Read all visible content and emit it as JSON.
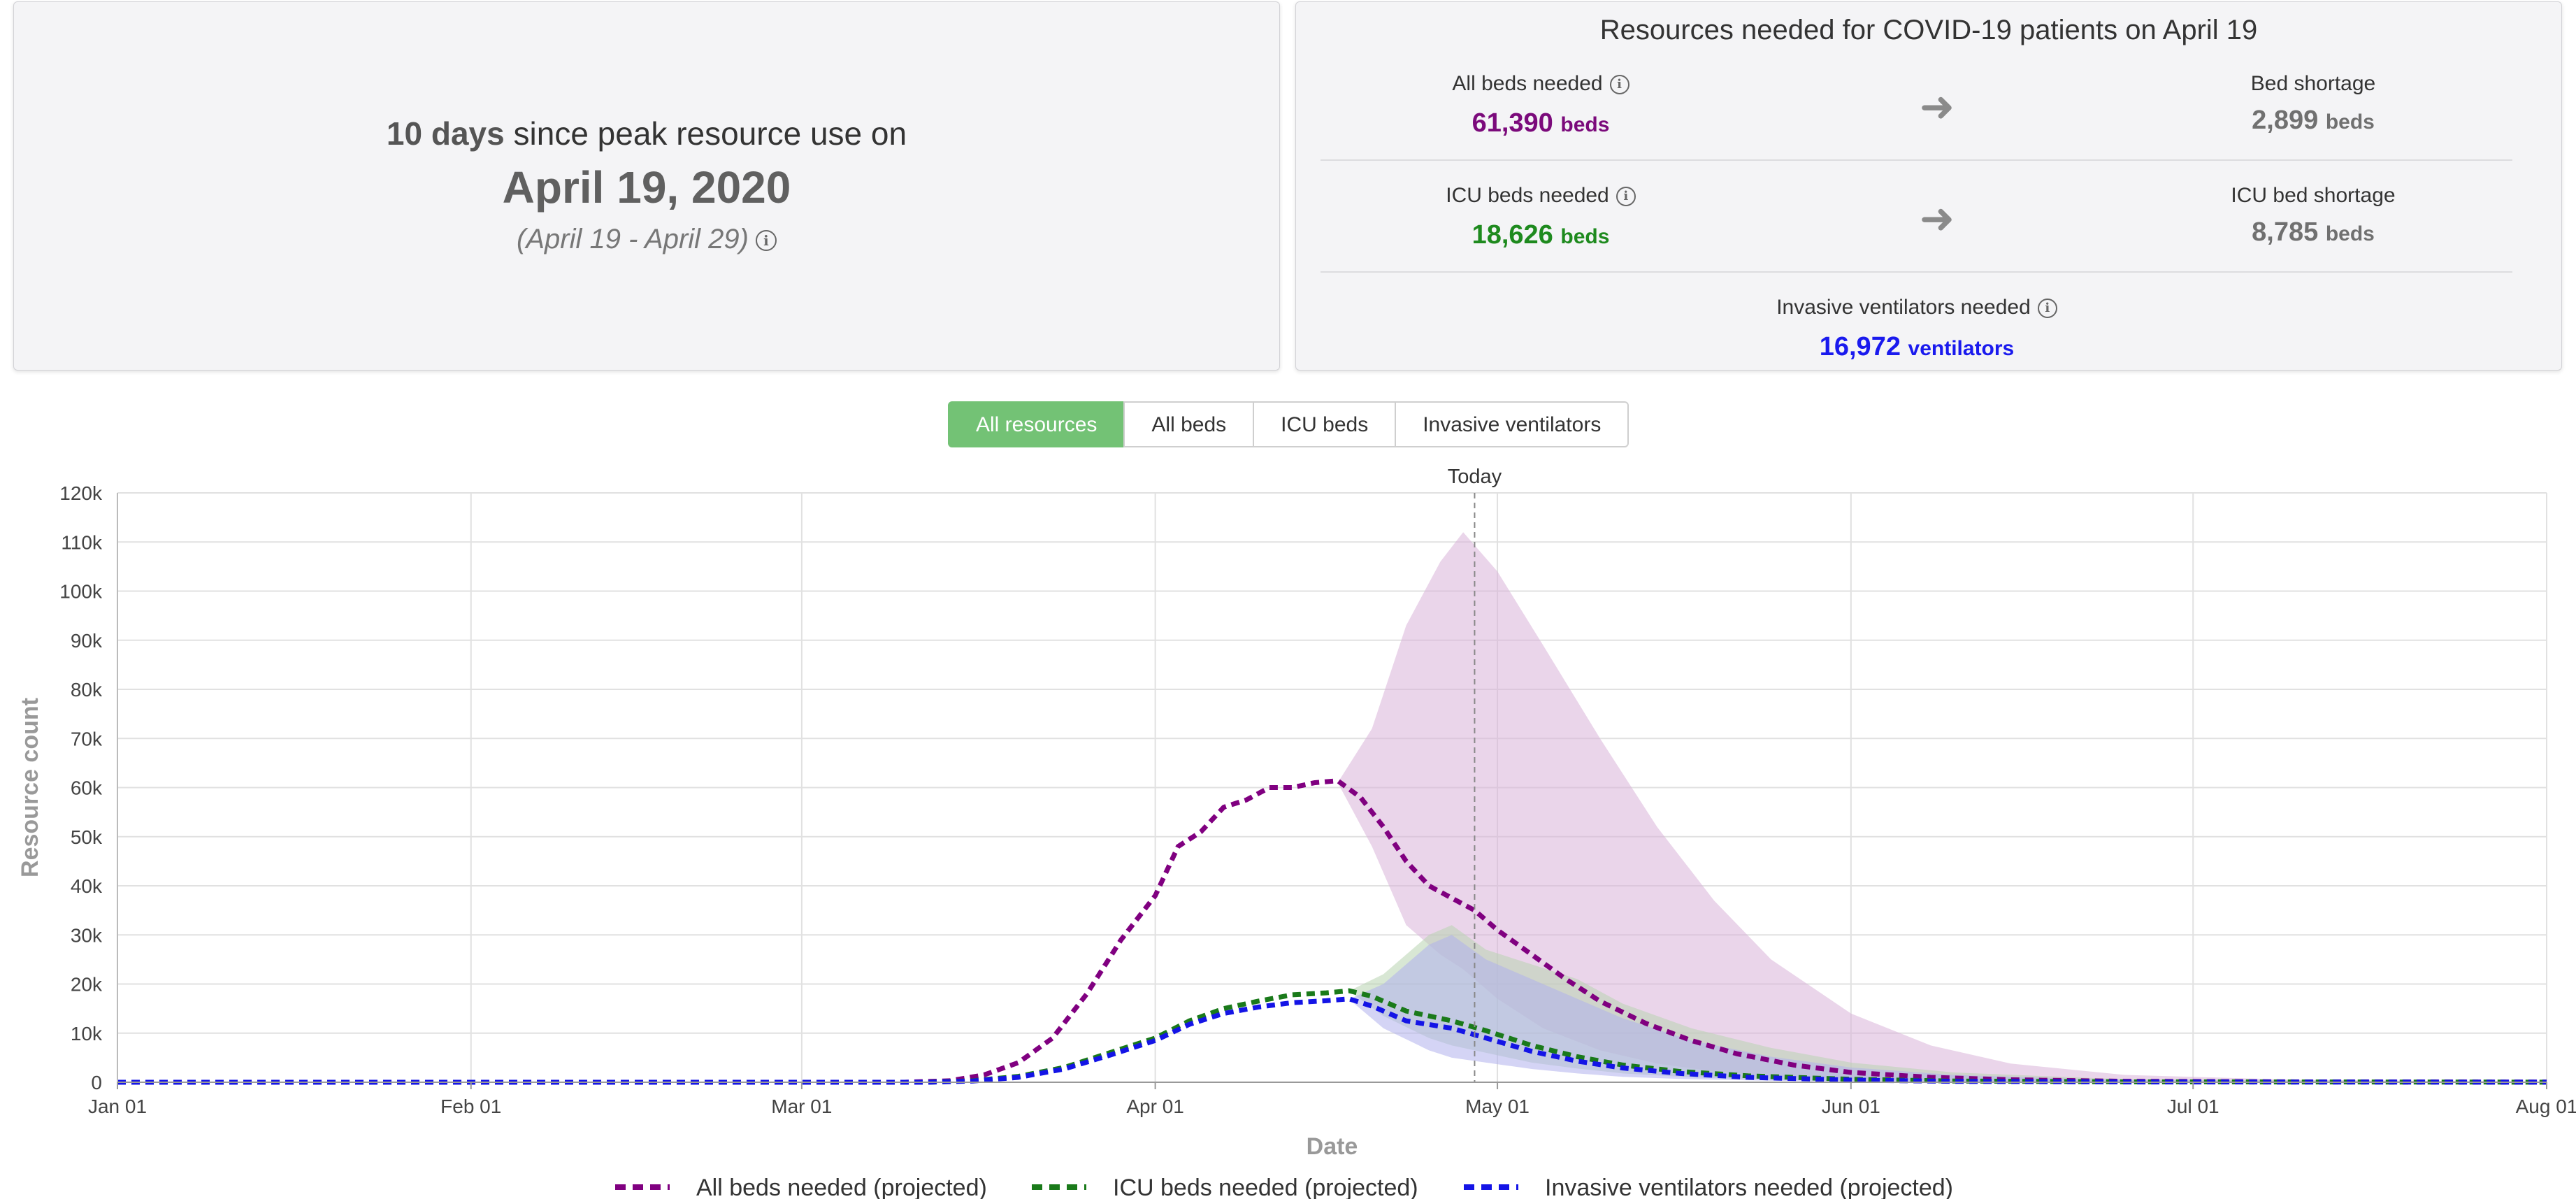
{
  "peak": {
    "days_value": "10",
    "days_unit": "days",
    "since_text": "since peak resource use on",
    "date": "April 19, 2020",
    "range": "(April 19 - April 29)"
  },
  "resources": {
    "title": "Resources needed for COVID-19 patients on April 19",
    "all_beds": {
      "label": "All beds needed",
      "value": "61,390",
      "unit": "beds",
      "color": "#7b0a7b"
    },
    "bed_shortage": {
      "label": "Bed shortage",
      "value": "2,899",
      "unit": "beds",
      "color": "#707070"
    },
    "icu_beds": {
      "label": "ICU beds needed",
      "value": "18,626",
      "unit": "beds",
      "color": "#1e8a1e"
    },
    "icu_shortage": {
      "label": "ICU bed shortage",
      "value": "8,785",
      "unit": "beds",
      "color": "#707070"
    },
    "ventilators": {
      "label": "Invasive ventilators needed",
      "value": "16,972",
      "unit": "ventilators",
      "color": "#1a1aee"
    }
  },
  "tabs": [
    {
      "label": "All resources",
      "active": true
    },
    {
      "label": "All beds",
      "active": false
    },
    {
      "label": "ICU beds",
      "active": false
    },
    {
      "label": "Invasive ventilators",
      "active": false
    }
  ],
  "chart_data": {
    "type": "line",
    "xlabel": "Date",
    "ylabel": "Resource count",
    "x_start": "2020-01-01",
    "x_end": "2020-08-01",
    "xticks": [
      {
        "date": "2020-01-01",
        "label": "Jan 01"
      },
      {
        "date": "2020-02-01",
        "label": "Feb 01"
      },
      {
        "date": "2020-03-01",
        "label": "Mar 01"
      },
      {
        "date": "2020-04-01",
        "label": "Apr 01"
      },
      {
        "date": "2020-05-01",
        "label": "May 01"
      },
      {
        "date": "2020-06-01",
        "label": "Jun 01"
      },
      {
        "date": "2020-07-01",
        "label": "Jul 01"
      },
      {
        "date": "2020-08-01",
        "label": "Aug 01"
      }
    ],
    "ylim": [
      0,
      120000
    ],
    "yticks": [
      {
        "value": 0,
        "label": "0"
      },
      {
        "value": 10000,
        "label": "10k"
      },
      {
        "value": 20000,
        "label": "20k"
      },
      {
        "value": 30000,
        "label": "30k"
      },
      {
        "value": 40000,
        "label": "40k"
      },
      {
        "value": 50000,
        "label": "50k"
      },
      {
        "value": 60000,
        "label": "60k"
      },
      {
        "value": 70000,
        "label": "70k"
      },
      {
        "value": 80000,
        "label": "80k"
      },
      {
        "value": 90000,
        "label": "90k"
      },
      {
        "value": 100000,
        "label": "100k"
      },
      {
        "value": 110000,
        "label": "110k"
      },
      {
        "value": 120000,
        "label": "120k"
      }
    ],
    "grid": true,
    "today": {
      "label": "Today",
      "date": "2020-04-29"
    },
    "legend_position": "bottom",
    "series": [
      {
        "name": "All beds needed (projected)",
        "color": "#800080",
        "band_color": "#d9b3d9",
        "points": [
          [
            "2020-01-01",
            0
          ],
          [
            "2020-03-10",
            0
          ],
          [
            "2020-03-14",
            300
          ],
          [
            "2020-03-17",
            1500
          ],
          [
            "2020-03-20",
            4000
          ],
          [
            "2020-03-23",
            9000
          ],
          [
            "2020-03-26",
            18000
          ],
          [
            "2020-03-29",
            29000
          ],
          [
            "2020-04-01",
            38000
          ],
          [
            "2020-04-03",
            48000
          ],
          [
            "2020-04-05",
            51000
          ],
          [
            "2020-04-07",
            56000
          ],
          [
            "2020-04-09",
            57500
          ],
          [
            "2020-04-11",
            60000
          ],
          [
            "2020-04-13",
            60000
          ],
          [
            "2020-04-15",
            61000
          ],
          [
            "2020-04-17",
            61390
          ],
          [
            "2020-04-19",
            58000
          ],
          [
            "2020-04-21",
            52000
          ],
          [
            "2020-04-23",
            45000
          ],
          [
            "2020-04-25",
            40000
          ],
          [
            "2020-04-27",
            37500
          ],
          [
            "2020-04-29",
            35000
          ],
          [
            "2020-05-01",
            31000
          ],
          [
            "2020-05-04",
            26000
          ],
          [
            "2020-05-07",
            21000
          ],
          [
            "2020-05-10",
            16500
          ],
          [
            "2020-05-14",
            12000
          ],
          [
            "2020-05-18",
            8500
          ],
          [
            "2020-05-22",
            5800
          ],
          [
            "2020-05-27",
            3500
          ],
          [
            "2020-06-01",
            2000
          ],
          [
            "2020-06-08",
            1000
          ],
          [
            "2020-06-15",
            500
          ],
          [
            "2020-06-25",
            200
          ],
          [
            "2020-07-10",
            80
          ],
          [
            "2020-08-01",
            30
          ]
        ],
        "band": [
          [
            "2020-04-17",
            61000,
            61000
          ],
          [
            "2020-04-20",
            48000,
            72000
          ],
          [
            "2020-04-23",
            32000,
            93000
          ],
          [
            "2020-04-26",
            26000,
            106000
          ],
          [
            "2020-04-28",
            23000,
            112000
          ],
          [
            "2020-05-01",
            17000,
            104000
          ],
          [
            "2020-05-05",
            11000,
            89000
          ],
          [
            "2020-05-10",
            6500,
            70000
          ],
          [
            "2020-05-15",
            3800,
            52000
          ],
          [
            "2020-05-20",
            2200,
            37000
          ],
          [
            "2020-05-25",
            1300,
            25000
          ],
          [
            "2020-06-01",
            700,
            14000
          ],
          [
            "2020-06-08",
            350,
            7500
          ],
          [
            "2020-06-15",
            180,
            3800
          ],
          [
            "2020-06-25",
            80,
            1500
          ],
          [
            "2020-07-10",
            30,
            500
          ],
          [
            "2020-08-01",
            10,
            120
          ]
        ]
      },
      {
        "name": "ICU beds needed (projected)",
        "color": "#1a7a1a",
        "band_color": "#b8d4b0",
        "points": [
          [
            "2020-01-01",
            0
          ],
          [
            "2020-03-12",
            0
          ],
          [
            "2020-03-16",
            300
          ],
          [
            "2020-03-20",
            1200
          ],
          [
            "2020-03-24",
            3000
          ],
          [
            "2020-03-28",
            6000
          ],
          [
            "2020-04-01",
            9000
          ],
          [
            "2020-04-04",
            12500
          ],
          [
            "2020-04-07",
            15000
          ],
          [
            "2020-04-10",
            16500
          ],
          [
            "2020-04-13",
            17800
          ],
          [
            "2020-04-16",
            18200
          ],
          [
            "2020-04-18",
            18626
          ],
          [
            "2020-04-20",
            17500
          ],
          [
            "2020-04-23",
            14500
          ],
          [
            "2020-04-27",
            12500
          ],
          [
            "2020-04-30",
            10500
          ],
          [
            "2020-05-04",
            7500
          ],
          [
            "2020-05-08",
            5200
          ],
          [
            "2020-05-12",
            3500
          ],
          [
            "2020-05-17",
            2200
          ],
          [
            "2020-05-23",
            1300
          ],
          [
            "2020-06-01",
            600
          ],
          [
            "2020-06-10",
            250
          ],
          [
            "2020-06-25",
            80
          ],
          [
            "2020-08-01",
            20
          ]
        ],
        "band": [
          [
            "2020-04-18",
            18600,
            18600
          ],
          [
            "2020-04-21",
            13500,
            22000
          ],
          [
            "2020-04-25",
            9000,
            30000
          ],
          [
            "2020-04-27",
            7500,
            32000
          ],
          [
            "2020-04-30",
            6000,
            27000
          ],
          [
            "2020-05-04",
            4000,
            24000
          ],
          [
            "2020-05-08",
            2800,
            21000
          ],
          [
            "2020-05-12",
            1800,
            16000
          ],
          [
            "2020-05-18",
            1000,
            11000
          ],
          [
            "2020-05-25",
            500,
            7000
          ],
          [
            "2020-06-01",
            250,
            4000
          ],
          [
            "2020-06-10",
            100,
            2000
          ],
          [
            "2020-06-25",
            40,
            600
          ],
          [
            "2020-08-01",
            5,
            80
          ]
        ]
      },
      {
        "name": "Invasive ventilators needed (projected)",
        "color": "#1414e6",
        "band_color": "#b0b0ec",
        "points": [
          [
            "2020-01-01",
            0
          ],
          [
            "2020-03-12",
            0
          ],
          [
            "2020-03-16",
            250
          ],
          [
            "2020-03-20",
            1000
          ],
          [
            "2020-03-24",
            2700
          ],
          [
            "2020-03-28",
            5500
          ],
          [
            "2020-04-01",
            8500
          ],
          [
            "2020-04-04",
            11800
          ],
          [
            "2020-04-07",
            14000
          ],
          [
            "2020-04-10",
            15300
          ],
          [
            "2020-04-13",
            16200
          ],
          [
            "2020-04-16",
            16600
          ],
          [
            "2020-04-18",
            16972
          ],
          [
            "2020-04-20",
            15500
          ],
          [
            "2020-04-23",
            12500
          ],
          [
            "2020-04-27",
            11000
          ],
          [
            "2020-04-30",
            9000
          ],
          [
            "2020-05-04",
            6300
          ],
          [
            "2020-05-08",
            4300
          ],
          [
            "2020-05-12",
            2900
          ],
          [
            "2020-05-17",
            1800
          ],
          [
            "2020-05-23",
            1000
          ],
          [
            "2020-06-01",
            450
          ],
          [
            "2020-06-10",
            180
          ],
          [
            "2020-06-25",
            60
          ],
          [
            "2020-08-01",
            15
          ]
        ],
        "band": [
          [
            "2020-04-18",
            16900,
            16900
          ],
          [
            "2020-04-21",
            11000,
            20000
          ],
          [
            "2020-04-25",
            6500,
            28000
          ],
          [
            "2020-04-27",
            5000,
            30000
          ],
          [
            "2020-04-30",
            4000,
            25000
          ],
          [
            "2020-05-04",
            2700,
            21000
          ],
          [
            "2020-05-08",
            1800,
            17000
          ],
          [
            "2020-05-12",
            1100,
            13000
          ],
          [
            "2020-05-18",
            600,
            8500
          ],
          [
            "2020-05-25",
            300,
            5200
          ],
          [
            "2020-06-01",
            150,
            3000
          ],
          [
            "2020-06-10",
            60,
            1500
          ],
          [
            "2020-06-25",
            20,
            400
          ],
          [
            "2020-08-01",
            3,
            50
          ]
        ]
      }
    ]
  }
}
